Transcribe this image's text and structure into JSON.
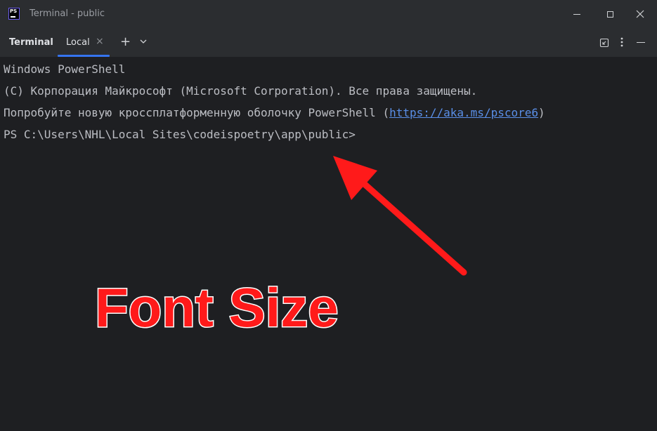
{
  "window": {
    "title": "Terminal - public",
    "app_icon_text": "PS",
    "controls": [
      "minimize",
      "maximize",
      "close"
    ]
  },
  "toolwindow": {
    "title": "Terminal",
    "tabs": [
      {
        "label": "Local",
        "active": true
      }
    ],
    "new_tab_label": "+",
    "accent_color": "#3574f0"
  },
  "terminal": {
    "lines": [
      "Windows PowerShell",
      "(C) Корпорация Майкрософт (Microsoft Corporation). Все права защищены.",
      "Попробуйте новую кроссплатформенную оболочку PowerShell (",
      "PS C:\\Users\\NHL\\Local Sites\\codeispoetry\\app\\public>"
    ],
    "link_text": "https://aka.ms/pscore6",
    "link_suffix": ")"
  },
  "annotation": {
    "text": "Font Size",
    "color": "#ff1a1a"
  }
}
